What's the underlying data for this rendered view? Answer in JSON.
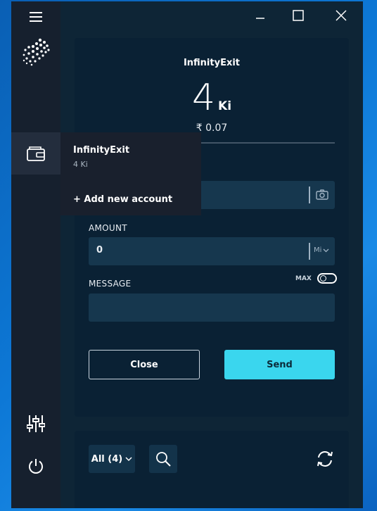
{
  "window": {
    "controls": {
      "minimize_icon": "minimize-icon",
      "maximize_icon": "maximize-icon",
      "close_icon": "close-icon"
    }
  },
  "sidebar": {
    "menu_icon": "hamburger-menu-icon",
    "logo": "iota-logo",
    "wallet_icon": "wallet-icon",
    "settings_icon": "settings-sliders-icon",
    "power_icon": "power-icon"
  },
  "account_menu": {
    "account_name": "InfinityExit",
    "account_balance": "4 Ki",
    "add_account_label": "+ Add new account"
  },
  "send_card": {
    "account_title": "InfinityExit",
    "balance_value": "4",
    "balance_unit": "Ki",
    "fiat_value": "₹ 0.07",
    "address_field": {
      "value": "",
      "camera_icon": "camera-icon"
    },
    "amount_label": "AMOUNT",
    "amount_value": "0",
    "amount_unit": "Mi",
    "max_label": "MAX",
    "max_toggle_on": false,
    "message_label": "MESSAGE",
    "message_value": "",
    "close_button": "Close",
    "send_button": "Send"
  },
  "history": {
    "filter_label": "All (4)",
    "search_icon": "search-icon",
    "sync_icon": "sync-icon"
  },
  "colors": {
    "desktop_blue": "#0d78d6",
    "sidebar_bg": "#16202e",
    "main_bg": "#0e2536",
    "card_bg": "#0a2134",
    "field_bg": "#16374e",
    "accent_cyan": "#3ad6ee"
  }
}
